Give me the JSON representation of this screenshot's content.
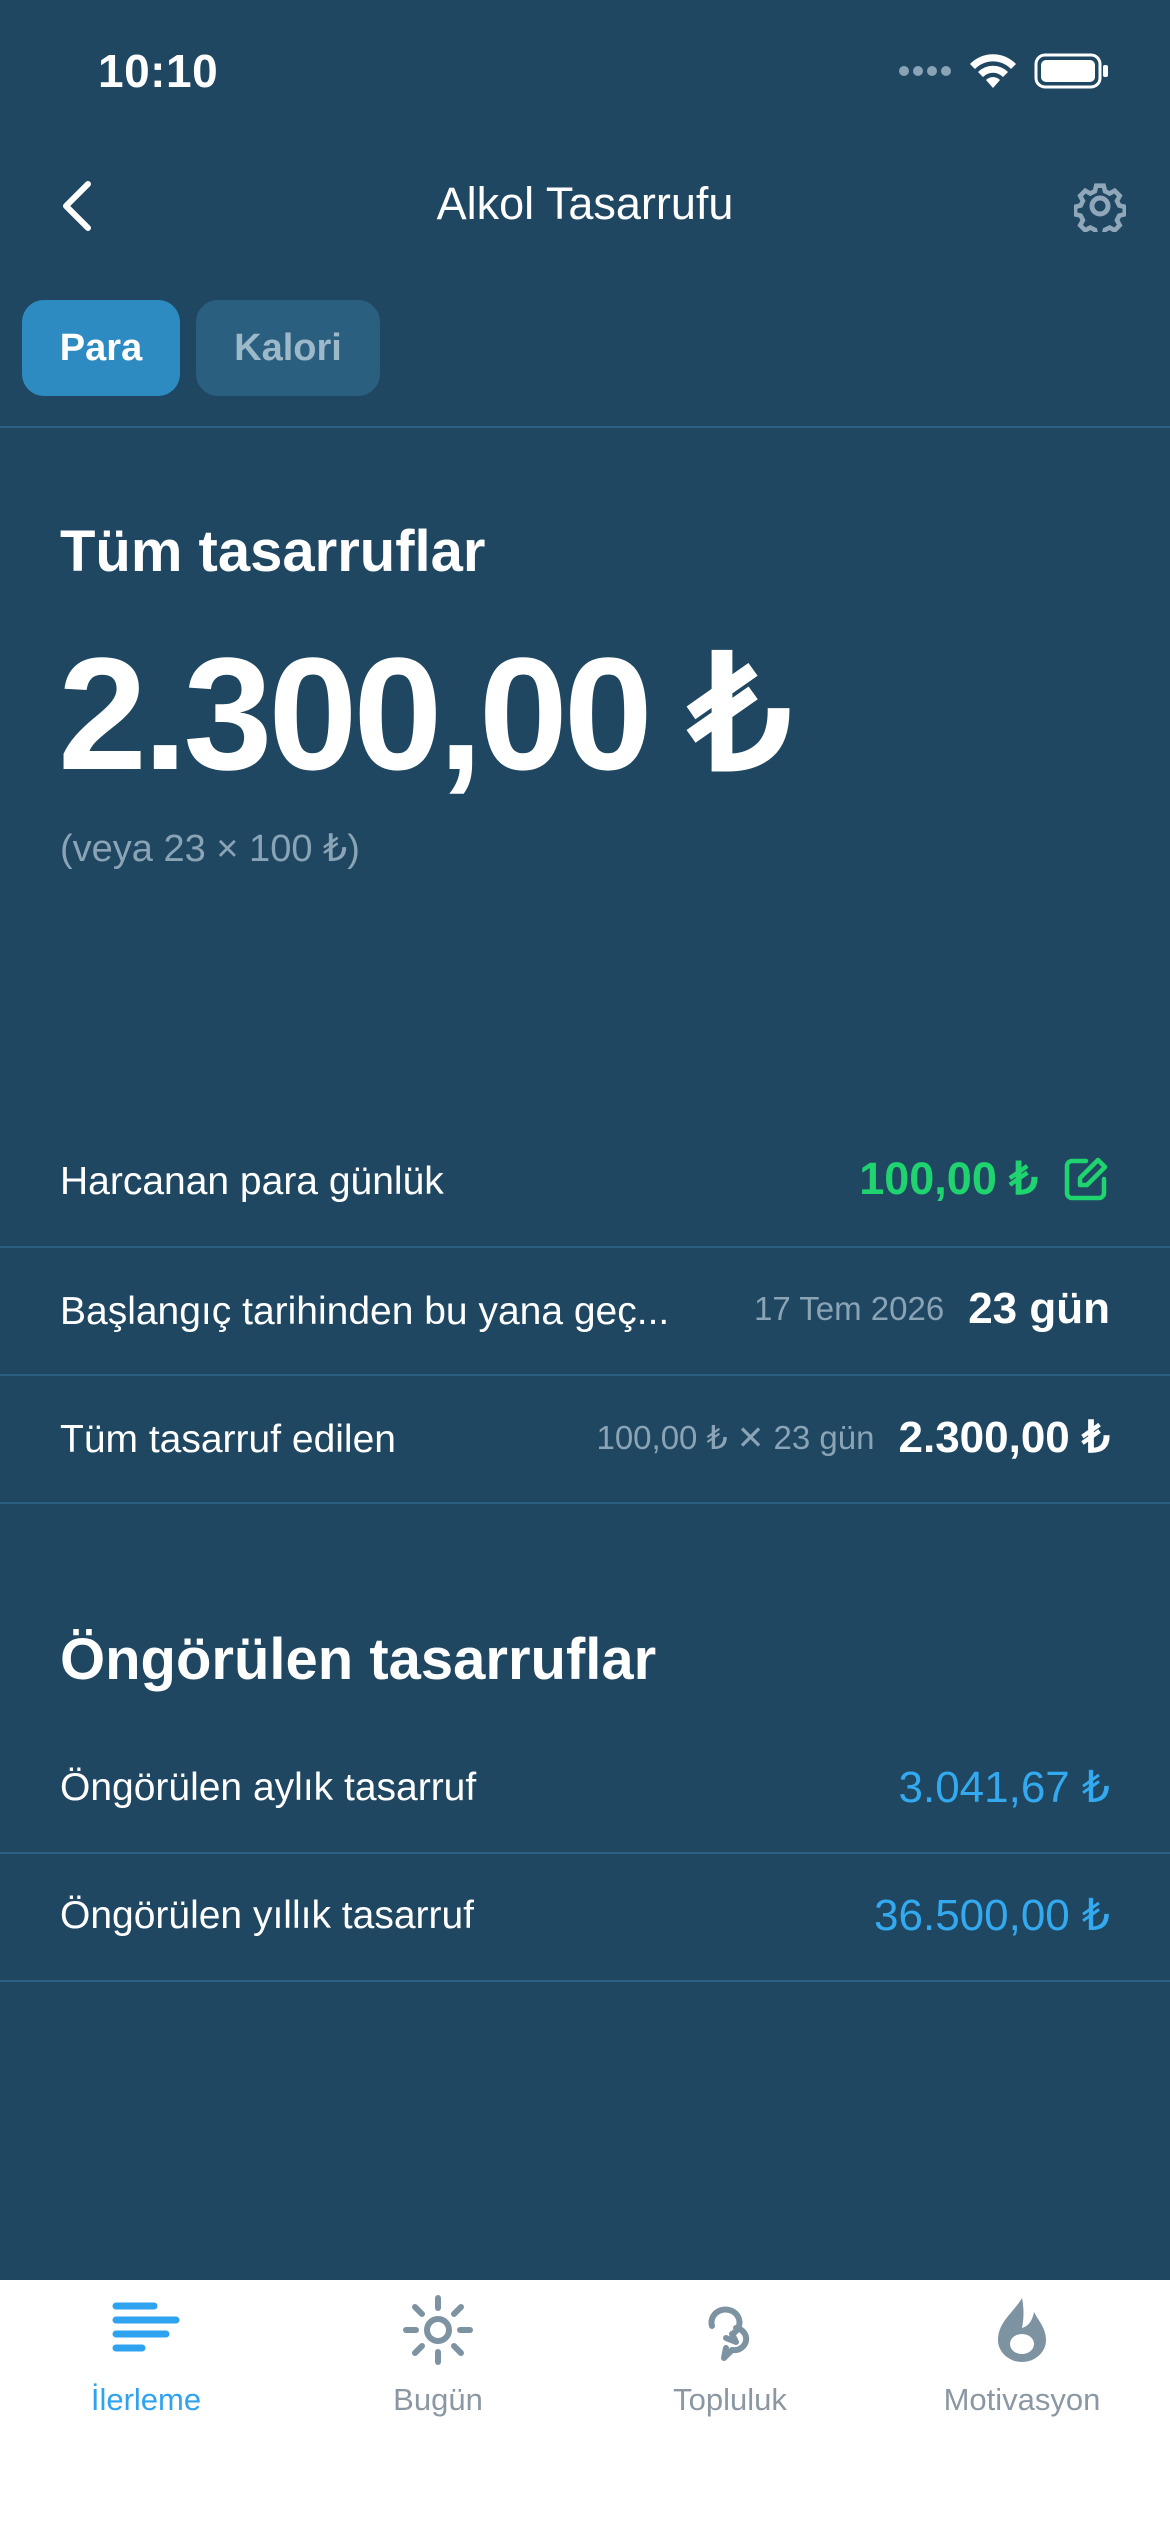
{
  "status_bar": {
    "time": "10:10"
  },
  "nav": {
    "title": "Alkol Tasarrufu"
  },
  "tabs": [
    {
      "label": "Para",
      "active": true
    },
    {
      "label": "Kalori",
      "active": false
    }
  ],
  "summary": {
    "title": "Tüm tasarruflar",
    "amount": "2.300,00 ₺",
    "note": "(veya 23 × 100 ₺)"
  },
  "rows": {
    "daily": {
      "label": "Harcanan para günlük",
      "value": "100,00 ₺"
    },
    "since": {
      "label": "Başlangıç tarihinden bu yana geç...",
      "date": "17 Tem 2026",
      "value": "23 gün"
    },
    "total": {
      "label": "Tüm tasarruf edilen",
      "formula": "100,00 ₺ ✕ 23 gün",
      "value": "2.300,00 ₺"
    }
  },
  "projected": {
    "title": "Öngörülen tasarruflar",
    "monthly": {
      "label": "Öngörülen aylık tasarruf",
      "value": "3.041,67 ₺"
    },
    "yearly": {
      "label": "Öngörülen yıllık tasarruf",
      "value": "36.500,00 ₺"
    }
  },
  "tabbar": [
    {
      "label": "İlerleme",
      "icon": "progress-bars-icon",
      "active": true
    },
    {
      "label": "Bugün",
      "icon": "sun-icon",
      "active": false
    },
    {
      "label": "Topluluk",
      "icon": "community-chat-icon",
      "active": false
    },
    {
      "label": "Motivasyon",
      "icon": "motivation-flame-icon",
      "active": false
    }
  ],
  "colors": {
    "background": "#1f4761",
    "accent": "#2d8bc2",
    "green": "#1fd36f",
    "blue": "#33aaf0"
  }
}
